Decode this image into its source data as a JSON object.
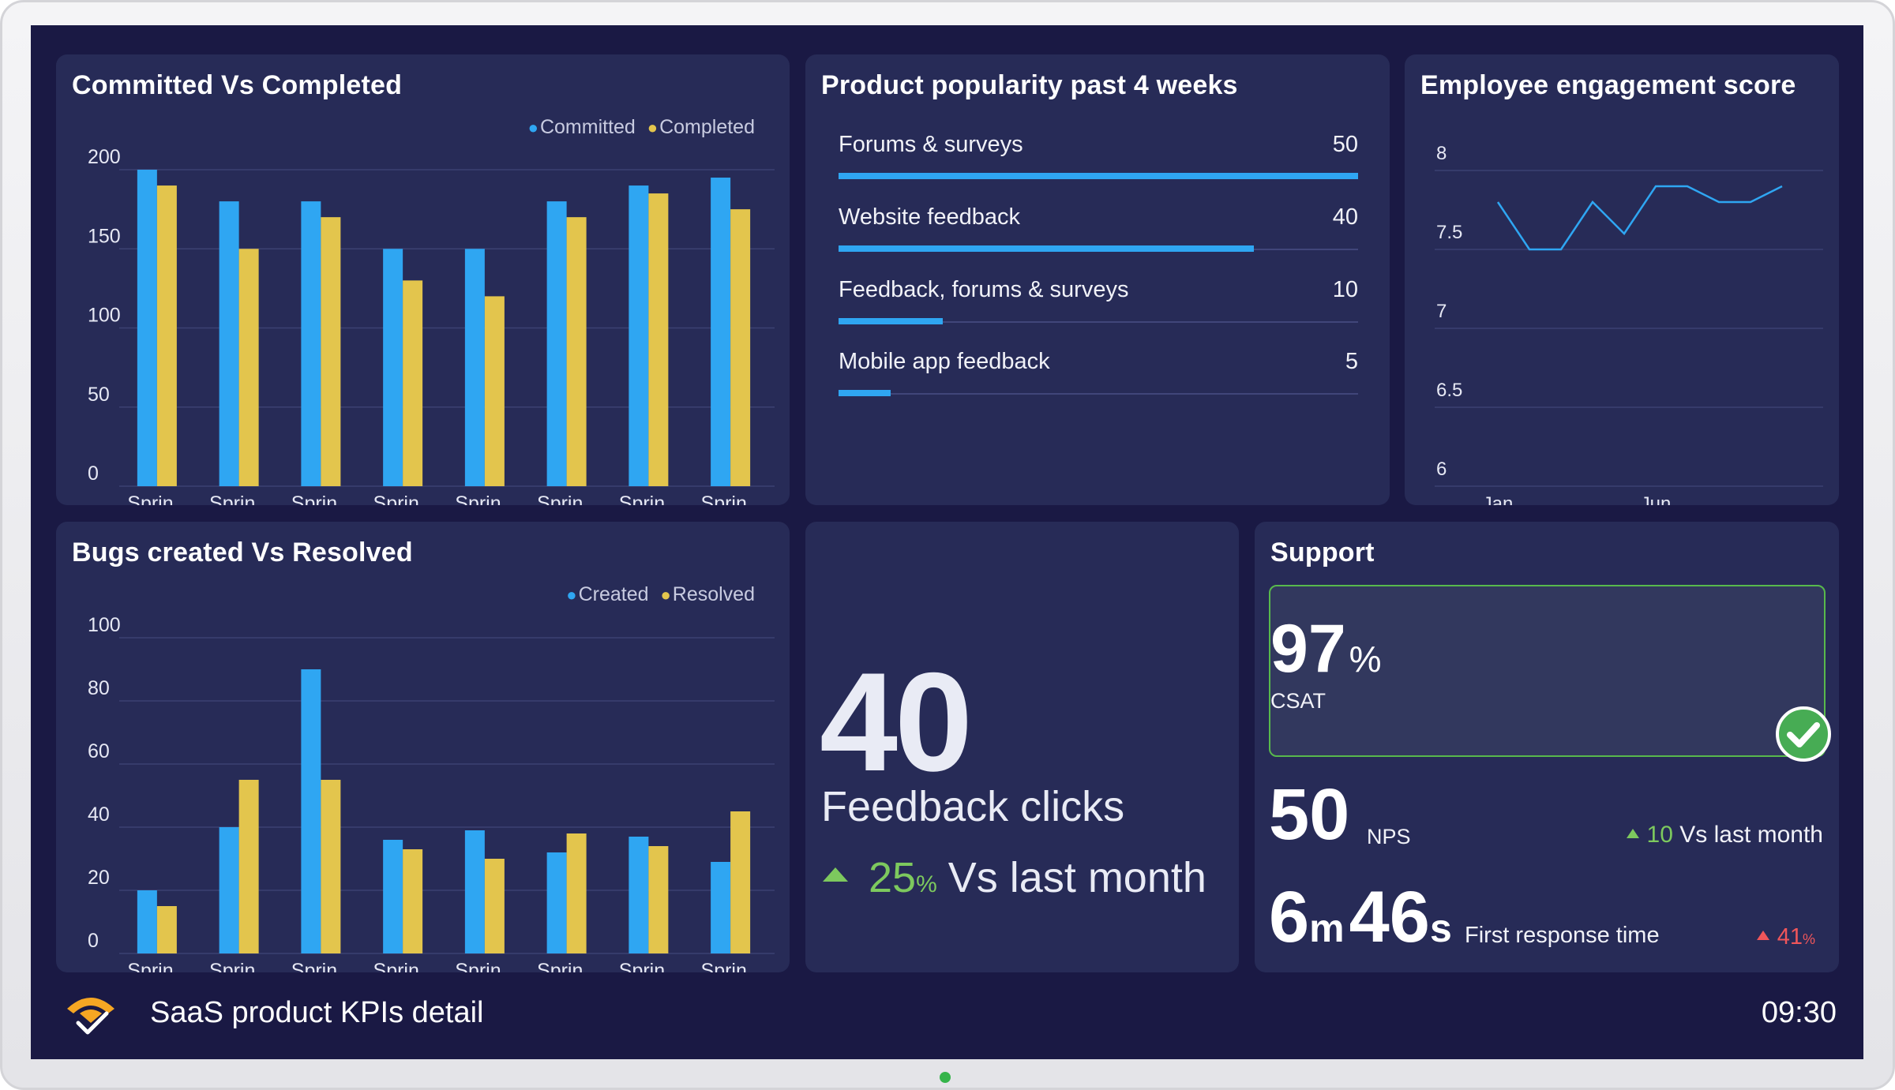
{
  "footer": {
    "title": "SaaS product KPIs detail",
    "time": "09:30"
  },
  "colors": {
    "background": "#1a1944",
    "panel": "#272b57",
    "series_blue": "#2fa6f2",
    "series_yellow": "#e3c54d",
    "positive": "#7dc95e",
    "negative": "#f0565a"
  },
  "committed": {
    "title": "Committed Vs Completed",
    "legend": [
      "Committed",
      "Completed"
    ]
  },
  "bugs": {
    "title": "Bugs created Vs Resolved",
    "legend": [
      "Created",
      "Resolved"
    ]
  },
  "popularity": {
    "title": "Product popularity past 4 weeks",
    "items": [
      {
        "label": "Forums & surveys",
        "value": "50",
        "fraction": 1.0
      },
      {
        "label": "Website feedback",
        "value": "40",
        "fraction": 0.8
      },
      {
        "label": "Feedback, forums & surveys",
        "value": "10",
        "fraction": 0.2
      },
      {
        "label": "Mobile app feedback",
        "value": "5",
        "fraction": 0.1
      }
    ]
  },
  "engagement": {
    "title": "Employee engagement score"
  },
  "feedback": {
    "value": "40",
    "label": "Feedback clicks",
    "trend_value": "25",
    "trend_unit": "%",
    "trend_text": "Vs last month"
  },
  "support": {
    "title": "Support",
    "csat_value": "97",
    "csat_unit": "%",
    "csat_label": "CSAT",
    "nps_value": "50",
    "nps_label": "NPS",
    "nps_trend_value": "10",
    "nps_trend_text": "Vs last month",
    "frt_minutes": "6",
    "frt_minutes_unit": "m",
    "frt_seconds": "46",
    "frt_seconds_unit": "s",
    "frt_label": "First response time",
    "frt_trend_value": "41",
    "frt_trend_unit": "%"
  },
  "chart_data": [
    {
      "type": "bar",
      "title": "Committed Vs Completed",
      "categories": [
        "Sprin...",
        "Sprin...",
        "Sprin...",
        "Sprin...",
        "Sprin...",
        "Sprin...",
        "Sprin...",
        "Sprin..."
      ],
      "series": [
        {
          "name": "Committed",
          "values": [
            200,
            180,
            180,
            150,
            150,
            180,
            190,
            195
          ]
        },
        {
          "name": "Completed",
          "values": [
            190,
            150,
            170,
            130,
            120,
            170,
            185,
            175
          ]
        }
      ],
      "yticks": [
        0,
        50,
        100,
        150,
        200
      ],
      "ylim": [
        0,
        200
      ],
      "grid": true,
      "legend": "top-right"
    },
    {
      "type": "bar",
      "title": "Bugs created Vs Resolved",
      "categories": [
        "Sprin...",
        "Sprin...",
        "Sprin...",
        "Sprin...",
        "Sprin...",
        "Sprin...",
        "Sprin...",
        "Sprin..."
      ],
      "series": [
        {
          "name": "Created",
          "values": [
            20,
            40,
            90,
            36,
            39,
            32,
            37,
            29
          ]
        },
        {
          "name": "Resolved",
          "values": [
            15,
            55,
            55,
            33,
            30,
            38,
            34,
            45
          ]
        }
      ],
      "yticks": [
        0,
        20,
        40,
        60,
        80,
        100
      ],
      "ylim": [
        0,
        100
      ],
      "grid": true,
      "legend": "top-right"
    },
    {
      "type": "line",
      "title": "Employee engagement score",
      "x": [
        1,
        2,
        3,
        4,
        5,
        6,
        7,
        8,
        9,
        10
      ],
      "xticks": [
        {
          "x": 1,
          "label": "Jan"
        },
        {
          "x": 6,
          "label": "Jun"
        }
      ],
      "series": [
        {
          "values": [
            7.8,
            7.5,
            7.5,
            7.8,
            7.6,
            7.9,
            7.9,
            7.8,
            7.8,
            7.9
          ]
        }
      ],
      "yticks": [
        6,
        6.5,
        7,
        7.5,
        8
      ],
      "ylim": [
        6,
        8
      ],
      "grid": true
    }
  ]
}
